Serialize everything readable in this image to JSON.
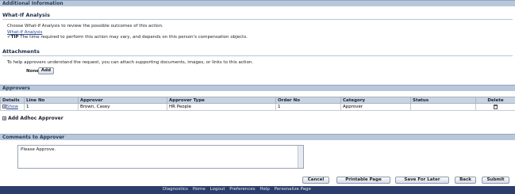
{
  "sections": {
    "additional_info": "Additional Information",
    "what_if": {
      "heading": "What-If Analysis",
      "instruction": "Choose What-If Analysis to review the possible outcomes of this action.",
      "link": "What-If Analysis",
      "tip_label": "TIP",
      "tip_text": "The time required to perform this action may vary, and depends on this person's compensation objects."
    },
    "attachments": {
      "heading": "Attachments",
      "instruction": "To help approvers understand the request, you can attach supporting documents, images, or links to this action.",
      "none_label": "None",
      "add_button": "Add"
    },
    "approvers": {
      "title": "Approvers",
      "columns": [
        "Details",
        "Line No",
        "Approver",
        "Approver Type",
        "Order No",
        "Category",
        "Status",
        "Delete"
      ],
      "rows": [
        {
          "details": "Show",
          "line_no": "1",
          "approver": "Brown, Casey",
          "approver_type": "HR People",
          "order_no": "1",
          "category": "Approver",
          "status": ""
        }
      ],
      "add_adhoc": "Add Adhoc Approver"
    },
    "comments": {
      "title": "Comments to Approver",
      "value": "Please Approve."
    }
  },
  "buttons": {
    "cancel": "Cancel",
    "printable": "Printable Page",
    "save_later": "Save For Later",
    "back": "Back",
    "submit": "Submit"
  },
  "footer_links": [
    "Diagnostics",
    "Home",
    "Logout",
    "Preferences",
    "Help",
    "Personalize Page"
  ]
}
